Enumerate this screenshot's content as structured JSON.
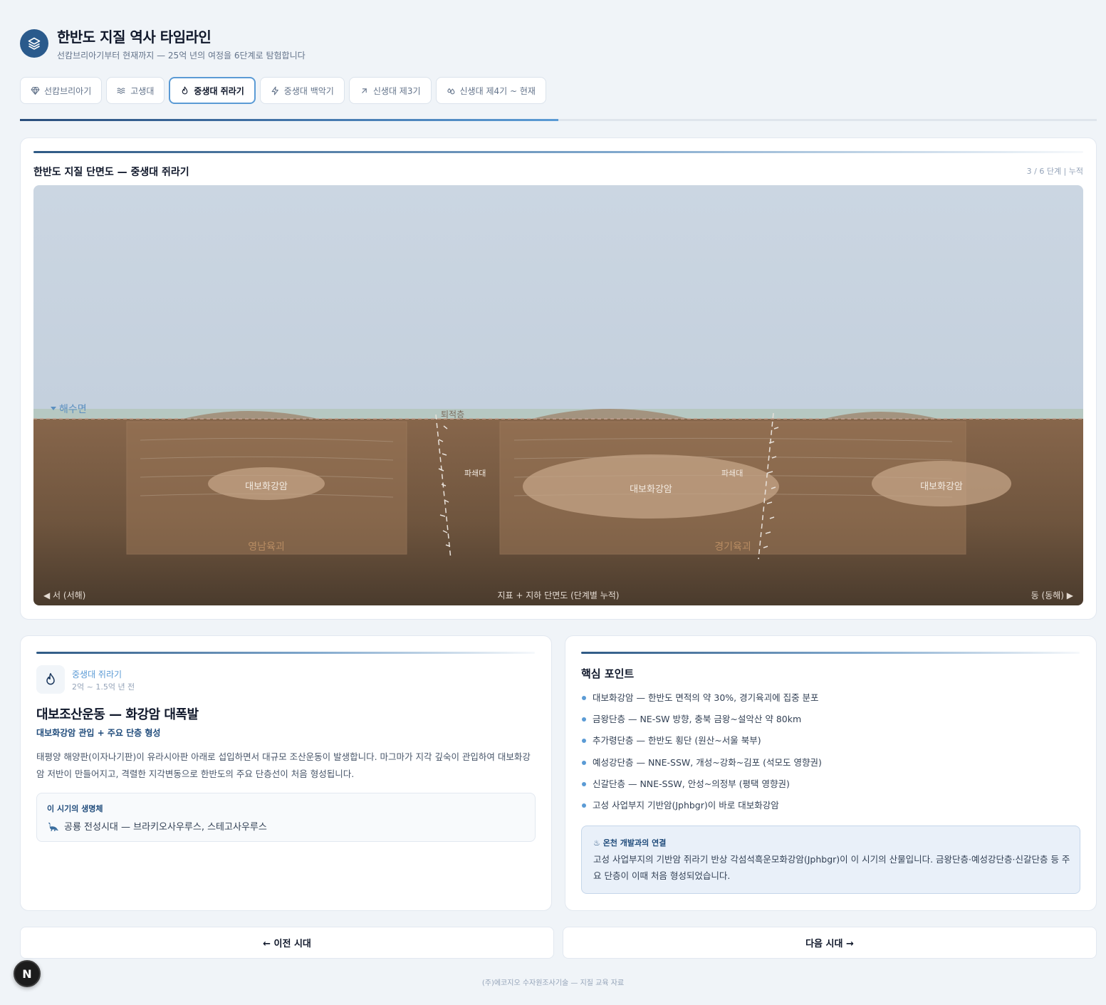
{
  "header": {
    "title": "한반도 지질 역사 타임라인",
    "subtitle": "선캄브리아기부터 현재까지 — 25억 년의 여정을 6단계로 탐험합니다",
    "logo_icon": "layers-icon"
  },
  "tabs": [
    {
      "label": "선캄브리아기",
      "icon": "gem-icon",
      "active": false
    },
    {
      "label": "고생대",
      "icon": "waves-icon",
      "active": false
    },
    {
      "label": "중생대 쥐라기",
      "icon": "flame-icon",
      "active": true
    },
    {
      "label": "중생대 백악기",
      "icon": "zap-icon",
      "active": false
    },
    {
      "label": "신생대 제3기",
      "icon": "arrow-up-right-icon",
      "active": false
    },
    {
      "label": "신생대 제4기 ~ 현재",
      "icon": "droplets-icon",
      "active": false
    }
  ],
  "progress": {
    "current": 3,
    "total": 6
  },
  "cross_section": {
    "title": "한반도 지질 단면도 — 중생대 쥐라기",
    "stage_note": "3 / 6 단계 | 누적",
    "sea_level_label": "해수면",
    "sediment_label": "퇴적층",
    "granite_label": "대보화강암",
    "fault_zone_label": "파쇄대",
    "massif_left_label": "영남육괴",
    "massif_right_label": "경기육괴",
    "west_label": "◀ 서 (서해)",
    "center_label": "지표 + 지하 단면도 (단계별 누적)",
    "east_label": "동 (동해) ▶",
    "colors": {
      "sky": "#c8d4e0",
      "sea": "#b7c9c2",
      "crust_top": "#86654a",
      "crust_bottom": "#4a3a2c"
    }
  },
  "era": {
    "icon": "flame-icon",
    "name": "중생대 쥐라기",
    "time": "2억 ~ 1.5억 년 전",
    "event_title": "대보조산운동 — 화강암 대폭발",
    "event_subtitle": "대보화강암 관입 + 주요 단층 형성",
    "description": "태평양 해양판(이자나기판)이 유라시아판 아래로 섭입하면서 대규모 조산운동이 발생합니다. 마그마가 지각 깊숙이 관입하여 대보화강암 저반이 만들어지고, 격렬한 지각변동으로 한반도의 주요 단층선이 처음 형성됩니다.",
    "life_label": "이 시기의 생명체",
    "life_icon": "dinosaur-icon",
    "life_text": "공룡 전성시대 — 브라키오사우루스, 스테고사우루스"
  },
  "key_points": {
    "title": "핵심 포인트",
    "items": [
      "대보화강암 — 한반도 면적의 약 30%, 경기육괴에 집중 분포",
      "금왕단층 — NE-SW 방향, 충북 금왕~설악산 약 80km",
      "추가령단층 — 한반도 횡단 (원산~서울 북부)",
      "예성강단층 — NNE-SSW, 개성~강화~김포 (석모도 영향권)",
      "신갈단층 — NNE-SSW, 안성~의정부 (평택 영향권)",
      "고성 사업부지 기반암(Jphbgr)이 바로 대보화강암"
    ],
    "connection_label": "♨ 온천 개발과의 연결",
    "connection_text": "고성 사업부지의 기반암 쥐라기 반상 각섬석흑운모화강암(Jphbgr)이 이 시기의 산물입니다. 금왕단층·예성강단층·신갈단층 등 주요 단층이 이때 처음 형성되었습니다."
  },
  "nav": {
    "prev_label": "← 이전 시대",
    "next_label": "다음 시대 →"
  },
  "footer": {
    "text": "(주)에코지오 수자원조사기술 — 지질 교육 자료"
  },
  "fab": {
    "label": "N"
  }
}
